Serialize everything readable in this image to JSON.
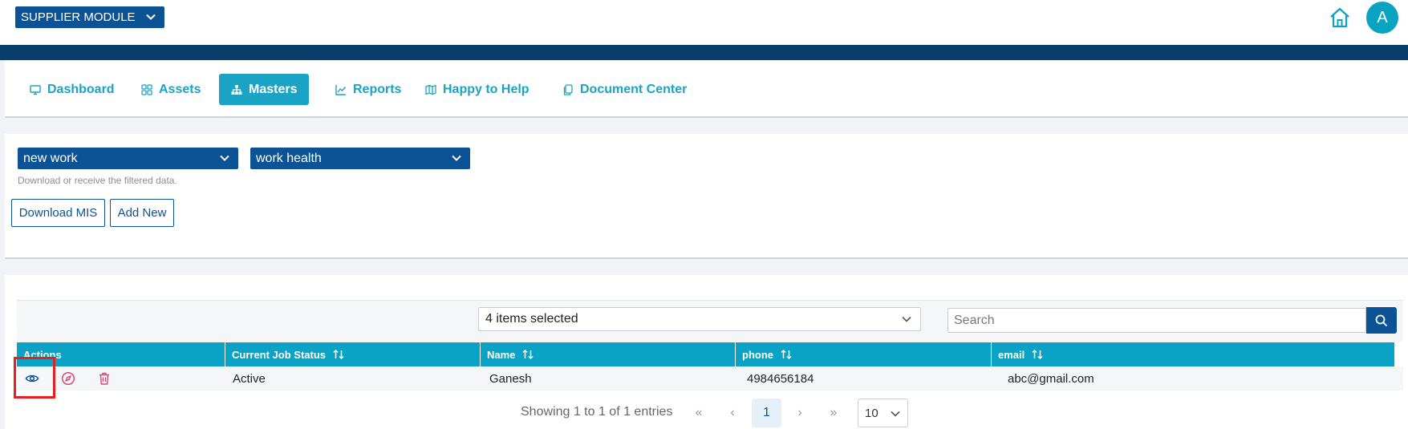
{
  "app": {
    "module_label": "SUPPLIER MODULE",
    "avatar_initial": "A"
  },
  "nav": {
    "items": [
      {
        "label": "Dashboard",
        "icon": "monitor-icon"
      },
      {
        "label": "Assets",
        "icon": "grid-icon"
      },
      {
        "label": "Masters",
        "icon": "sitemap-icon",
        "active": true
      },
      {
        "label": "Reports",
        "icon": "chart-line-icon"
      },
      {
        "label": "Happy to Help",
        "icon": "map-icon"
      },
      {
        "label": "Document Center",
        "icon": "documents-icon"
      }
    ]
  },
  "filters": {
    "first_select": "new work",
    "second_select": "work health",
    "hint": "Download or receive the filtered data.",
    "download_button": "Download MIS",
    "add_button": "Add New"
  },
  "table": {
    "columns_select": "4 items selected",
    "search_placeholder": "Search",
    "headers": [
      "Actions",
      "Current Job Status",
      "Name",
      "phone",
      "email"
    ],
    "rows": [
      {
        "status": "Active",
        "name": "Ganesh",
        "phone": "4984656184",
        "email": "abc@gmail.com"
      }
    ],
    "action_icons": [
      "eye-icon",
      "compass-icon",
      "trash-icon"
    ]
  },
  "pagination": {
    "summary": "Showing 1 to 1 of 1 entries",
    "first": "«",
    "prev": "‹",
    "current_page": "1",
    "next": "›",
    "last": "»",
    "page_size": "10"
  },
  "colors": {
    "primary_dark": "#0b5394",
    "accent": "#1ba3c6",
    "highlight": "#e62020",
    "danger": "#e0457b"
  }
}
